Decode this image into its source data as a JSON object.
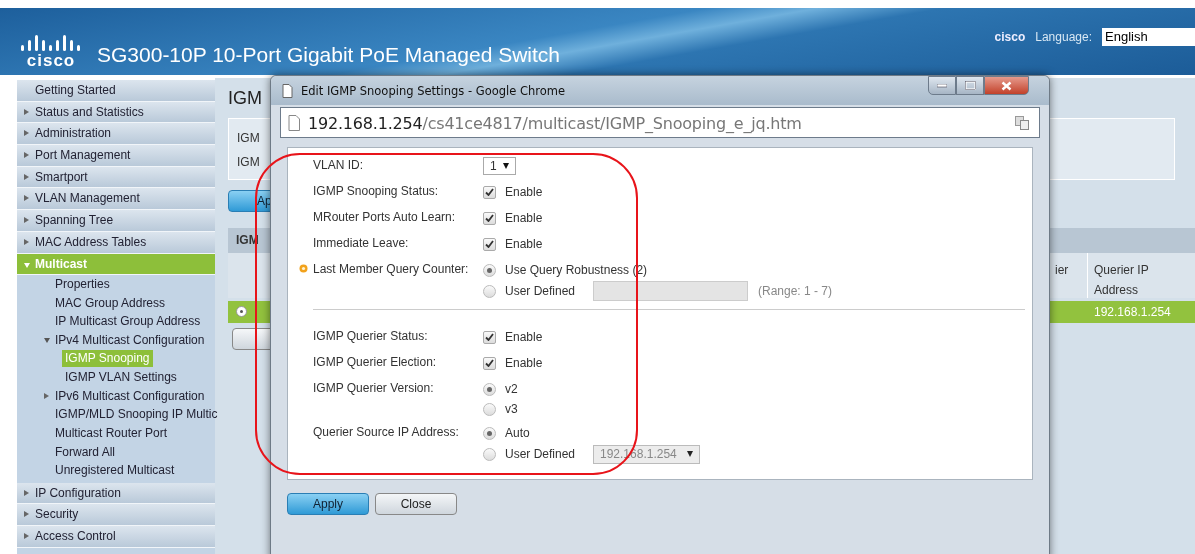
{
  "header": {
    "logo_text": "cisco",
    "title": "SG300-10P 10-Port Gigabit PoE Managed Switch",
    "user": "cisco",
    "language_label": "Language:",
    "language_value": "English"
  },
  "sidebar": {
    "items": [
      {
        "label": "Getting Started",
        "kind": "link"
      },
      {
        "label": "Status and Statistics",
        "kind": "group",
        "expanded": false
      },
      {
        "label": "Administration",
        "kind": "group",
        "expanded": false
      },
      {
        "label": "Port Management",
        "kind": "group",
        "expanded": false
      },
      {
        "label": "Smartport",
        "kind": "group",
        "expanded": false
      },
      {
        "label": "VLAN Management",
        "kind": "group",
        "expanded": false
      },
      {
        "label": "Spanning Tree",
        "kind": "group",
        "expanded": false
      },
      {
        "label": "MAC Address Tables",
        "kind": "group",
        "expanded": false
      },
      {
        "label": "Multicast",
        "kind": "group",
        "expanded": true,
        "children": [
          {
            "label": "Properties",
            "kind": "link",
            "selected": false
          },
          {
            "label": "MAC Group Address",
            "kind": "link",
            "selected": false
          },
          {
            "label": "IP Multicast Group Address",
            "kind": "link",
            "selected": false
          },
          {
            "label": "IPv4 Multicast Configuration",
            "kind": "group",
            "expanded": true,
            "children": [
              {
                "label": "IGMP Snooping",
                "kind": "link",
                "selected": true
              },
              {
                "label": "IGMP VLAN Settings",
                "kind": "link",
                "selected": false
              }
            ]
          },
          {
            "label": "IPv6 Multicast Configuration",
            "kind": "group",
            "expanded": false
          },
          {
            "label": "IGMP/MLD Snooping IP Multic",
            "kind": "link",
            "selected": false
          },
          {
            "label": "Multicast Router Port",
            "kind": "link",
            "selected": false
          },
          {
            "label": "Forward All",
            "kind": "link",
            "selected": false
          },
          {
            "label": "Unregistered Multicast",
            "kind": "link",
            "selected": false
          }
        ]
      },
      {
        "label": "IP Configuration",
        "kind": "group",
        "expanded": false
      },
      {
        "label": "Security",
        "kind": "group",
        "expanded": false
      },
      {
        "label": "Access Control",
        "kind": "group",
        "expanded": false
      }
    ]
  },
  "main": {
    "title": "IGM",
    "fields": [
      "IGM",
      "IGM"
    ],
    "apply_button": "Ap",
    "table": {
      "title": "IGM",
      "columns": [
        "ier",
        "Querier IP Address"
      ],
      "rows": [
        {
          "selected": true,
          "cells": [
            "",
            "192.168.1.254"
          ]
        }
      ]
    }
  },
  "popup": {
    "title": "Edit IGMP Snooping Settings - Google Chrome",
    "url_host": "192.168.1.254",
    "url_path": "/cs41ce4817/multicast/IGMP_Snooping_e_jq.htm",
    "form": [
      {
        "kind": "select",
        "label": "VLAN ID:",
        "value": "1",
        "flagged": false
      },
      {
        "kind": "checkbox",
        "label": "IGMP Snooping Status:",
        "option": "Enable",
        "checked": true,
        "flagged": false
      },
      {
        "kind": "checkbox",
        "label": "MRouter Ports Auto Learn:",
        "option": "Enable",
        "checked": true,
        "flagged": false
      },
      {
        "kind": "checkbox",
        "label": "Immediate Leave:",
        "option": "Enable",
        "checked": true,
        "flagged": false
      },
      {
        "kind": "radio",
        "label": "Last Member Query Counter:",
        "flagged": true,
        "options": [
          {
            "label": "Use Query Robustness (2)",
            "selected": true
          },
          {
            "label": "User Defined",
            "selected": false,
            "extra": {
              "kind": "text",
              "disabled": true,
              "hint": "(Range: 1 - 7)"
            }
          }
        ]
      },
      {
        "kind": "divider"
      },
      {
        "kind": "checkbox",
        "label": "IGMP Querier Status:",
        "option": "Enable",
        "checked": true,
        "flagged": false
      },
      {
        "kind": "checkbox",
        "label": "IGMP Querier Election:",
        "option": "Enable",
        "checked": true,
        "flagged": false
      },
      {
        "kind": "radio",
        "label": "IGMP Querier Version:",
        "flagged": false,
        "options": [
          {
            "label": "v2",
            "selected": true
          },
          {
            "label": "v3",
            "selected": false
          }
        ]
      },
      {
        "kind": "radio",
        "label": "Querier Source IP Address:",
        "flagged": false,
        "options": [
          {
            "label": "Auto",
            "selected": true
          },
          {
            "label": "User Defined",
            "selected": false,
            "extra": {
              "kind": "select",
              "disabled": true,
              "value": "192.168.1.254"
            }
          }
        ]
      }
    ],
    "buttons": [
      {
        "label": "Apply",
        "primary": true
      },
      {
        "label": "Close",
        "primary": false
      }
    ]
  }
}
